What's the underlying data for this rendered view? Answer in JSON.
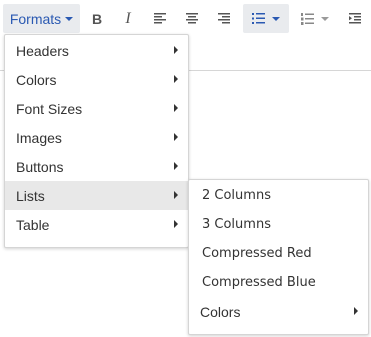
{
  "toolbar": {
    "formats_label": "Formats",
    "bold_label": "B",
    "italic_label": "I"
  },
  "formats_menu": {
    "items": [
      {
        "label": "Headers",
        "has_submenu": true
      },
      {
        "label": "Colors",
        "has_submenu": true
      },
      {
        "label": "Font Sizes",
        "has_submenu": true
      },
      {
        "label": "Images",
        "has_submenu": true
      },
      {
        "label": "Buttons",
        "has_submenu": true
      },
      {
        "label": "Lists",
        "has_submenu": true,
        "highlighted": true
      },
      {
        "label": "Table",
        "has_submenu": true
      }
    ]
  },
  "lists_menu": {
    "items": [
      {
        "label": "2 Columns"
      },
      {
        "label": "3 Columns"
      },
      {
        "label": "Compressed Red"
      },
      {
        "label": "Compressed Blue"
      },
      {
        "label": "Colors",
        "has_submenu": true
      }
    ]
  },
  "colors": {
    "accent": "#2a59b2",
    "active_bg": "#e9ebee",
    "highlight_bg": "#e8e8e8",
    "text": "#333333"
  },
  "icons": [
    "bold-icon",
    "italic-icon",
    "align-left-icon",
    "align-center-icon",
    "align-right-icon",
    "bullet-list-icon",
    "numbered-list-icon",
    "indent-icon"
  ]
}
